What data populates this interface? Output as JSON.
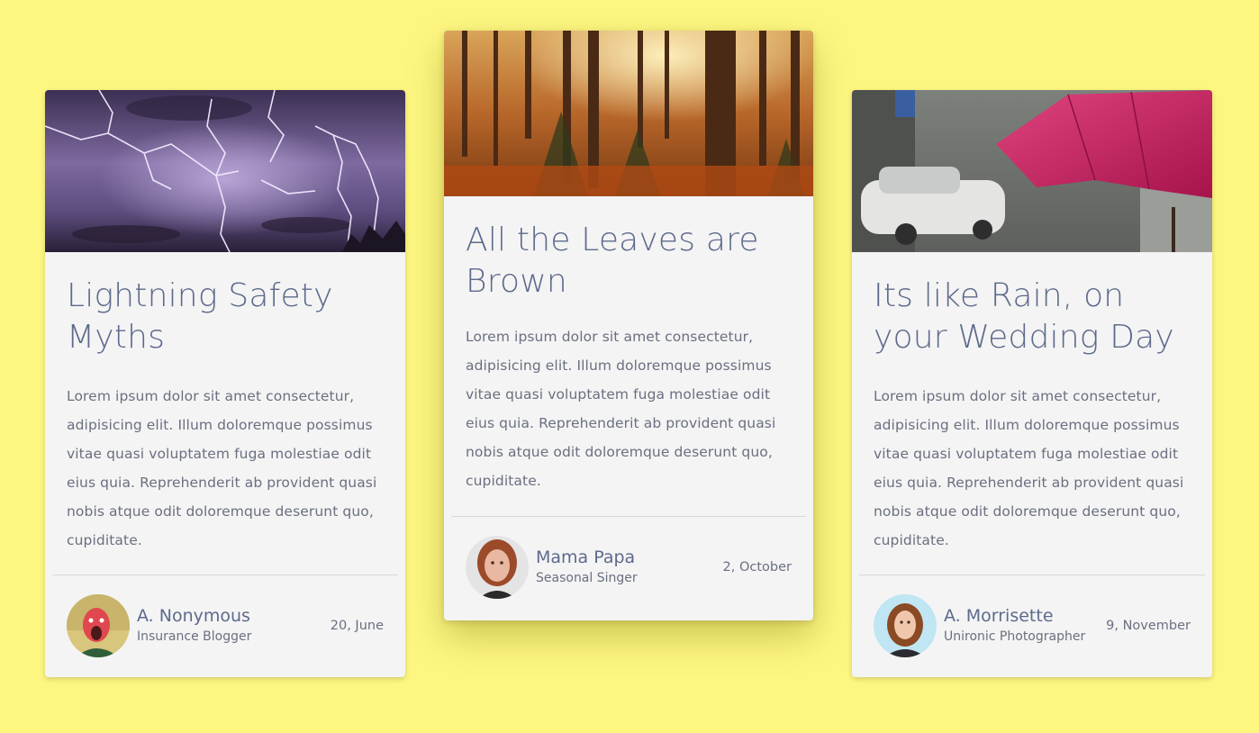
{
  "cards": [
    {
      "title": "Lightning Safety Myths",
      "text": "Lorem ipsum dolor sit amet consectetur, adipisicing elit. Illum doloremque possimus vitae quasi voluptatem fuga molestiae odit eius quia. Reprehenderit ab provident quasi nobis atque odit doloremque deserunt quo, cupiditate.",
      "author_name": "A. Nonymous",
      "author_role": "Insurance Blogger",
      "date": "20, June",
      "image": "lightning-storm-photo"
    },
    {
      "title": "All the Leaves are Brown",
      "text": "Lorem ipsum dolor sit amet consectetur, adipisicing elit. Illum doloremque possimus vitae quasi voluptatem fuga molestiae odit eius quia. Reprehenderit ab provident quasi nobis atque odit doloremque deserunt quo, cupiditate.",
      "author_name": "Mama Papa",
      "author_role": "Seasonal Singer",
      "date": "2, October",
      "image": "autumn-forest-photo"
    },
    {
      "title": "Its like Rain, on your Wedding Day",
      "text": "Lorem ipsum dolor sit amet consectetur, adipisicing elit. Illum doloremque possimus vitae quasi voluptatem fuga molestiae odit eius quia. Reprehenderit ab provident quasi nobis atque odit doloremque deserunt quo, cupiditate.",
      "author_name": "A. Morrisette",
      "author_role": "Unironic Photographer",
      "date": "9, November",
      "image": "pink-umbrella-rain-photo"
    }
  ],
  "colors": {
    "background": "#fdf781",
    "card": "#f4f4f4",
    "heading": "#5d6a8c",
    "text": "#6a6f80"
  }
}
